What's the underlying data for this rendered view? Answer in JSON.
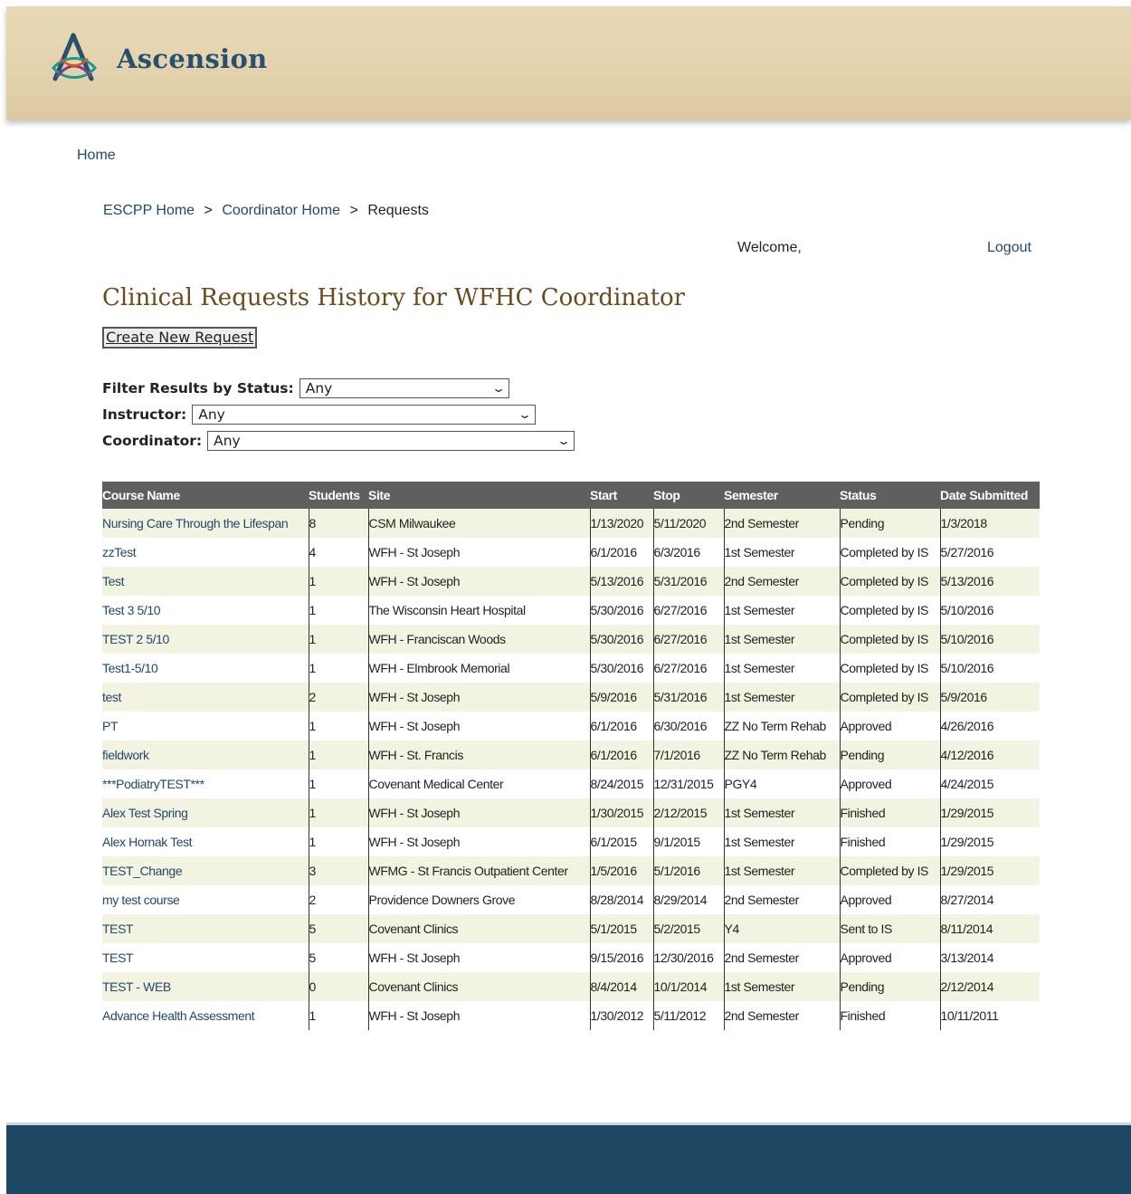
{
  "brand": {
    "name": "Ascension"
  },
  "nav": {
    "home": "Home"
  },
  "breadcrumb": {
    "items": [
      "ESCPP Home",
      "Coordinator Home",
      "Requests"
    ],
    "separator": ">"
  },
  "user": {
    "welcome": "Welcome,",
    "logout": "Logout"
  },
  "page": {
    "title": "Clinical Requests History for WFHC Coordinator",
    "create_button": "Create New Request"
  },
  "filters": {
    "status_label": "Filter Results by Status:",
    "status_value": "Any",
    "instructor_label": "Instructor:",
    "instructor_value": "Any",
    "coordinator_label": "Coordinator:",
    "coordinator_value": "Any"
  },
  "table": {
    "headers": [
      "Course Name",
      "Students",
      "Site",
      "Start",
      "Stop",
      "Semester",
      "Status",
      "Date Submitted"
    ],
    "rows": [
      [
        "Nursing Care Through the Lifespan",
        "8",
        "CSM Milwaukee",
        "1/13/2020",
        "5/11/2020",
        "2nd Semester",
        "Pending",
        "1/3/2018"
      ],
      [
        "zzTest",
        "4",
        "WFH - St Joseph",
        "6/1/2016",
        "6/3/2016",
        "1st Semester",
        "Completed by IS",
        "5/27/2016"
      ],
      [
        "Test",
        "1",
        "WFH - St Joseph",
        "5/13/2016",
        "5/31/2016",
        "2nd Semester",
        "Completed by IS",
        "5/13/2016"
      ],
      [
        "Test 3 5/10",
        "1",
        "The Wisconsin Heart Hospital",
        "5/30/2016",
        "6/27/2016",
        "1st Semester",
        "Completed by IS",
        "5/10/2016"
      ],
      [
        "TEST 2 5/10",
        "1",
        "WFH - Franciscan Woods",
        "5/30/2016",
        "6/27/2016",
        "1st Semester",
        "Completed by IS",
        "5/10/2016"
      ],
      [
        "Test1-5/10",
        "1",
        "WFH - Elmbrook Memorial",
        "5/30/2016",
        "6/27/2016",
        "1st Semester",
        "Completed by IS",
        "5/10/2016"
      ],
      [
        "test",
        "2",
        "WFH - St Joseph",
        "5/9/2016",
        "5/31/2016",
        "1st Semester",
        "Completed by IS",
        "5/9/2016"
      ],
      [
        "PT",
        "1",
        "WFH - St Joseph",
        "6/1/2016",
        "6/30/2016",
        "ZZ No Term Rehab",
        "Approved",
        "4/26/2016"
      ],
      [
        "fieldwork",
        "1",
        "WFH - St. Francis",
        "6/1/2016",
        "7/1/2016",
        "ZZ No Term Rehab",
        "Pending",
        "4/12/2016"
      ],
      [
        "***PodiatryTEST***",
        "1",
        "Covenant Medical Center",
        "8/24/2015",
        "12/31/2015",
        "PGY4",
        "Approved",
        "4/24/2015"
      ],
      [
        "Alex Test Spring",
        "1",
        "WFH - St Joseph",
        "1/30/2015",
        "2/12/2015",
        "1st Semester",
        "Finished",
        "1/29/2015"
      ],
      [
        "Alex Hornak Test",
        "1",
        "WFH - St Joseph",
        "6/1/2015",
        "9/1/2015",
        "1st Semester",
        "Finished",
        "1/29/2015"
      ],
      [
        "TEST_Change",
        "3",
        "WFMG - St Francis Outpatient Center",
        "1/5/2016",
        "5/1/2016",
        "1st Semester",
        "Completed by IS",
        "1/29/2015"
      ],
      [
        "my test course",
        "2",
        "Providence Downers Grove",
        "8/28/2014",
        "8/29/2014",
        "2nd Semester",
        "Approved",
        "8/27/2014"
      ],
      [
        "TEST",
        "5",
        "Covenant Clinics",
        "5/1/2015",
        "5/2/2015",
        "Y4",
        "Sent to IS",
        "8/11/2014"
      ],
      [
        "TEST",
        "5",
        "WFH - St Joseph",
        "9/15/2016",
        "12/30/2016",
        "2nd Semester",
        "Approved",
        "3/13/2014"
      ],
      [
        "TEST - WEB",
        "0",
        "Covenant Clinics",
        "8/4/2014",
        "10/1/2014",
        "1st Semester",
        "Pending",
        "2/12/2014"
      ],
      [
        "Advance Health Assessment",
        "1",
        "WFH - St Joseph",
        "1/30/2012",
        "5/11/2012",
        "2nd Semester",
        "Finished",
        "10/11/2011"
      ]
    ]
  },
  "colors": {
    "header_band": "#e6d6b2",
    "link": "#22496a",
    "title": "#6b4a1e",
    "table_header": "#5f5f5f",
    "row_alt": "#f3f3e1",
    "footer": "#1e4763"
  }
}
